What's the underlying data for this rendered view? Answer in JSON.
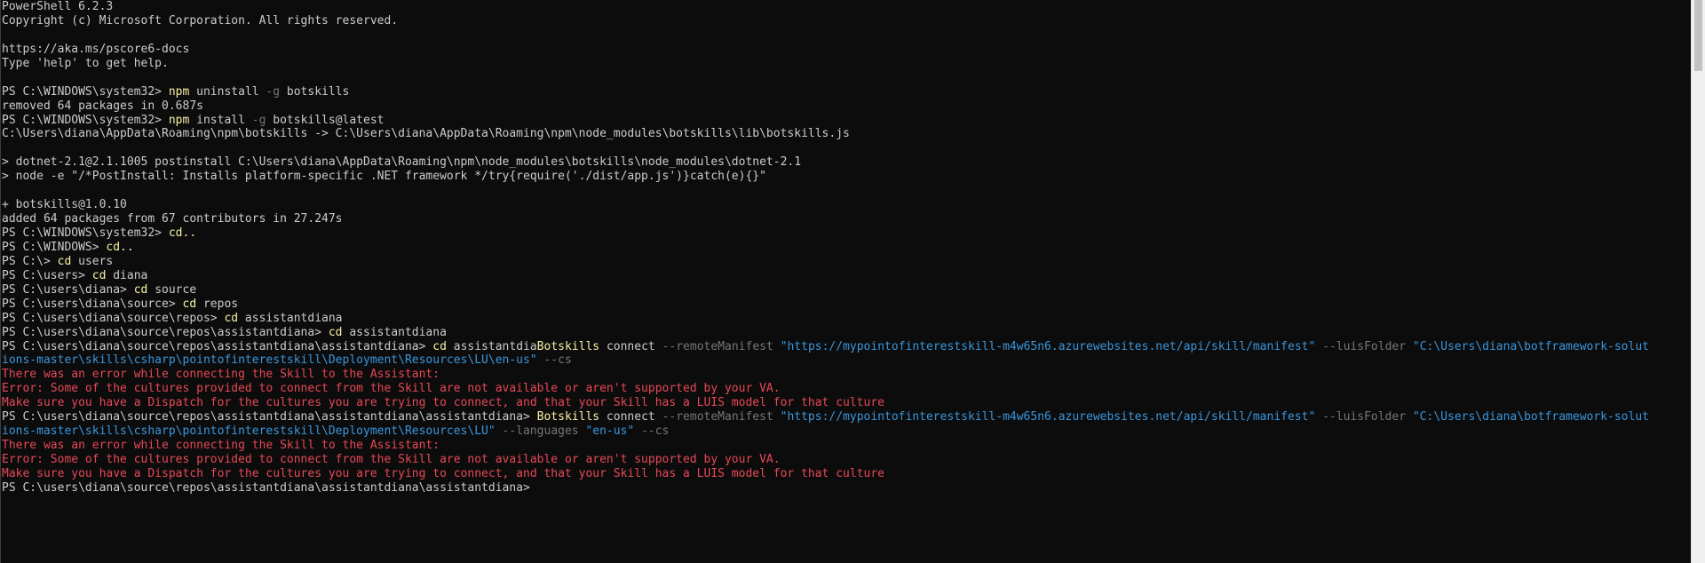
{
  "console": {
    "lines": [
      [
        {
          "t": "PowerShell 6.2.3",
          "c": "plain"
        }
      ],
      [
        {
          "t": "Copyright (c) Microsoft Corporation. All rights reserved.",
          "c": "plain"
        }
      ],
      [
        {
          "t": "",
          "c": "plain"
        }
      ],
      [
        {
          "t": "https://aka.ms/pscore6-docs",
          "c": "plain"
        }
      ],
      [
        {
          "t": "Type 'help' to get help.",
          "c": "plain"
        }
      ],
      [
        {
          "t": "",
          "c": "plain"
        }
      ],
      [
        {
          "t": "PS C:\\WINDOWS\\system32> ",
          "c": "plain"
        },
        {
          "t": "npm",
          "c": "cmd"
        },
        {
          "t": " uninstall ",
          "c": "plain"
        },
        {
          "t": "-g",
          "c": "par"
        },
        {
          "t": " botskills",
          "c": "plain"
        }
      ],
      [
        {
          "t": "removed 64 packages in 0.687s",
          "c": "plain"
        }
      ],
      [
        {
          "t": "PS C:\\WINDOWS\\system32> ",
          "c": "plain"
        },
        {
          "t": "npm",
          "c": "cmd"
        },
        {
          "t": " install ",
          "c": "plain"
        },
        {
          "t": "-g",
          "c": "par"
        },
        {
          "t": " botskills@latest",
          "c": "plain"
        }
      ],
      [
        {
          "t": "C:\\Users\\diana\\AppData\\Roaming\\npm\\botskills -> C:\\Users\\diana\\AppData\\Roaming\\npm\\node_modules\\botskills\\lib\\botskills.js",
          "c": "plain"
        }
      ],
      [
        {
          "t": "",
          "c": "plain"
        }
      ],
      [
        {
          "t": "> dotnet-2.1@2.1.1005 postinstall C:\\Users\\diana\\AppData\\Roaming\\npm\\node_modules\\botskills\\node_modules\\dotnet-2.1",
          "c": "plain"
        }
      ],
      [
        {
          "t": "> node -e \"/*PostInstall: Installs platform-specific .NET framework */try{require('./dist/app.js')}catch(e){}\"",
          "c": "plain"
        }
      ],
      [
        {
          "t": "",
          "c": "plain"
        }
      ],
      [
        {
          "t": "+ botskills@1.0.10",
          "c": "plain"
        }
      ],
      [
        {
          "t": "added 64 packages from 67 contributors in 27.247s",
          "c": "plain"
        }
      ],
      [
        {
          "t": "PS C:\\WINDOWS\\system32> ",
          "c": "plain"
        },
        {
          "t": "cd..",
          "c": "cmd"
        }
      ],
      [
        {
          "t": "PS C:\\WINDOWS> ",
          "c": "plain"
        },
        {
          "t": "cd..",
          "c": "cmd"
        }
      ],
      [
        {
          "t": "PS C:\\> ",
          "c": "plain"
        },
        {
          "t": "cd",
          "c": "cmd"
        },
        {
          "t": " users",
          "c": "plain"
        }
      ],
      [
        {
          "t": "PS C:\\users> ",
          "c": "plain"
        },
        {
          "t": "cd",
          "c": "cmd"
        },
        {
          "t": " diana",
          "c": "plain"
        }
      ],
      [
        {
          "t": "PS C:\\users\\diana> ",
          "c": "plain"
        },
        {
          "t": "cd",
          "c": "cmd"
        },
        {
          "t": " source",
          "c": "plain"
        }
      ],
      [
        {
          "t": "PS C:\\users\\diana\\source> ",
          "c": "plain"
        },
        {
          "t": "cd",
          "c": "cmd"
        },
        {
          "t": " repos",
          "c": "plain"
        }
      ],
      [
        {
          "t": "PS C:\\users\\diana\\source\\repos> ",
          "c": "plain"
        },
        {
          "t": "cd",
          "c": "cmd"
        },
        {
          "t": " assistantdiana",
          "c": "plain"
        }
      ],
      [
        {
          "t": "PS C:\\users\\diana\\source\\repos\\assistantdiana> ",
          "c": "plain"
        },
        {
          "t": "cd",
          "c": "cmd"
        },
        {
          "t": " assistantdiana",
          "c": "plain"
        }
      ],
      [
        {
          "t": "PS C:\\users\\diana\\source\\repos\\assistantdiana\\assistantdiana> ",
          "c": "plain"
        },
        {
          "t": "cd",
          "c": "cmd"
        },
        {
          "t": " assistantdia",
          "c": "plain"
        },
        {
          "t": "Botskills",
          "c": "cmd"
        },
        {
          "t": " connect ",
          "c": "plain"
        },
        {
          "t": "--remoteManifest",
          "c": "par"
        },
        {
          "t": " ",
          "c": "plain"
        },
        {
          "t": "\"https://mypointofinterestskill-m4w65n6.azurewebsites.net/api/skill/manifest\"",
          "c": "str"
        },
        {
          "t": " ",
          "c": "plain"
        },
        {
          "t": "--luisFolder",
          "c": "par"
        },
        {
          "t": " ",
          "c": "plain"
        },
        {
          "t": "\"C:\\Users\\diana\\botframework-solut",
          "c": "str"
        }
      ],
      [
        {
          "t": "ions-master\\skills\\csharp\\pointofinterestskill\\Deployment\\Resources\\LU\\en-us\"",
          "c": "str"
        },
        {
          "t": " ",
          "c": "plain"
        },
        {
          "t": "--cs",
          "c": "par"
        }
      ],
      [
        {
          "t": "There was an error while connecting the Skill to the Assistant:",
          "c": "err"
        }
      ],
      [
        {
          "t": "Error: Some of the cultures provided to connect from the Skill are not available or aren't supported by your VA.",
          "c": "err"
        }
      ],
      [
        {
          "t": "Make sure you have a Dispatch for the cultures you are trying to connect, and that your Skill has a LUIS model for that culture",
          "c": "err"
        }
      ],
      [
        {
          "t": "PS C:\\users\\diana\\source\\repos\\assistantdiana\\assistantdiana\\assistantdiana> ",
          "c": "plain"
        },
        {
          "t": "Botskills",
          "c": "cmd"
        },
        {
          "t": " connect ",
          "c": "plain"
        },
        {
          "t": "--remoteManifest",
          "c": "par"
        },
        {
          "t": " ",
          "c": "plain"
        },
        {
          "t": "\"https://mypointofinterestskill-m4w65n6.azurewebsites.net/api/skill/manifest\"",
          "c": "str"
        },
        {
          "t": " ",
          "c": "plain"
        },
        {
          "t": "--luisFolder",
          "c": "par"
        },
        {
          "t": " ",
          "c": "plain"
        },
        {
          "t": "\"C:\\Users\\diana\\botframework-solut",
          "c": "str"
        }
      ],
      [
        {
          "t": "ions-master\\skills\\csharp\\pointofinterestskill\\Deployment\\Resources\\LU\"",
          "c": "str"
        },
        {
          "t": " ",
          "c": "plain"
        },
        {
          "t": "--languages",
          "c": "par"
        },
        {
          "t": " ",
          "c": "plain"
        },
        {
          "t": "\"en-us\"",
          "c": "str"
        },
        {
          "t": " ",
          "c": "plain"
        },
        {
          "t": "--cs",
          "c": "par"
        }
      ],
      [
        {
          "t": "There was an error while connecting the Skill to the Assistant:",
          "c": "err"
        }
      ],
      [
        {
          "t": "Error: Some of the cultures provided to connect from the Skill are not available or aren't supported by your VA.",
          "c": "err"
        }
      ],
      [
        {
          "t": "Make sure you have a Dispatch for the cultures you are trying to connect, and that your Skill has a LUIS model for that culture",
          "c": "err"
        }
      ],
      [
        {
          "t": "PS C:\\users\\diana\\source\\repos\\assistantdiana\\assistantdiana\\assistantdiana>",
          "c": "plain"
        }
      ]
    ]
  },
  "colors": {
    "background": "#0c0c0c",
    "text": "#cccccc",
    "command": "#f9f1a5",
    "parameter": "#767676",
    "string": "#3a96dd",
    "error": "#e74856"
  }
}
